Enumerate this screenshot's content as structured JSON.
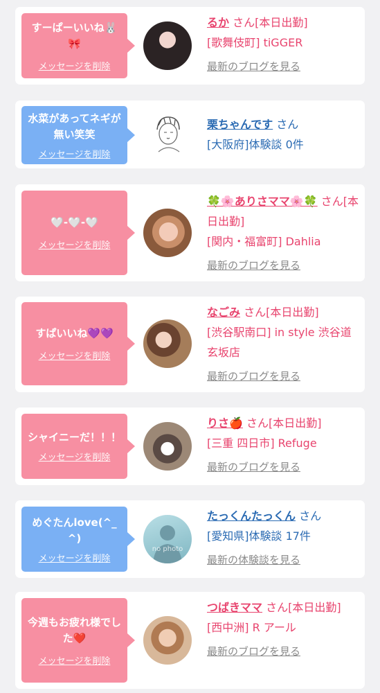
{
  "colors": {
    "pink_bubble": "#f78fa2",
    "blue_bubble": "#7ab0f4",
    "pink_text": "#e8446e",
    "blue_text": "#2b6bb3",
    "link_gray": "#8a8a8a"
  },
  "delete_label": "メッセージを削除",
  "entries": [
    {
      "message": "すーぱーいいね🐰🎀",
      "name": "るか",
      "honorific": "さん[本日出勤]",
      "location_shop": "[歌舞伎町] tiGGER",
      "link_label": "最新のブログを見る"
    },
    {
      "message": "水菜があってネギが無い笑笑",
      "name": "栗ちゃんです",
      "honorific": "さん",
      "location_shop": "[大阪府]体験談 0件"
    },
    {
      "message": "🤍-🤍-🤍",
      "name": "🍀🌸ありさママ🌸🍀",
      "honorific": "さん[本日出勤]",
      "location_shop": "[関内・福富町] Dahlia",
      "link_label": "最新のブログを見る"
    },
    {
      "message": "すぱいいね💜💜",
      "name": "なごみ",
      "honorific": "さん[本日出勤]",
      "location_shop": "[渋谷駅南口] in style 渋谷道玄坂店",
      "link_label": "最新のブログを見る"
    },
    {
      "message": "シャイニーだ！！！",
      "name": "りさ🍎",
      "honorific": "さん[本日出勤]",
      "location_shop": "[三重 四日市] Refuge",
      "link_label": "最新のブログを見る"
    },
    {
      "message": "めぐたんlove(^_^)",
      "name": "たっくんたっくん",
      "honorific": "さん",
      "location_shop": "[愛知県]体験談 17件",
      "link_label": "最新の体験談を見る",
      "avatar_text": "no photo"
    },
    {
      "message": "今週もお疲れ様でした❤️",
      "name": "つばきママ",
      "honorific": "さん[本日出勤]",
      "location_shop": "[西中洲] R アール",
      "link_label": "最新のブログを見る"
    }
  ]
}
